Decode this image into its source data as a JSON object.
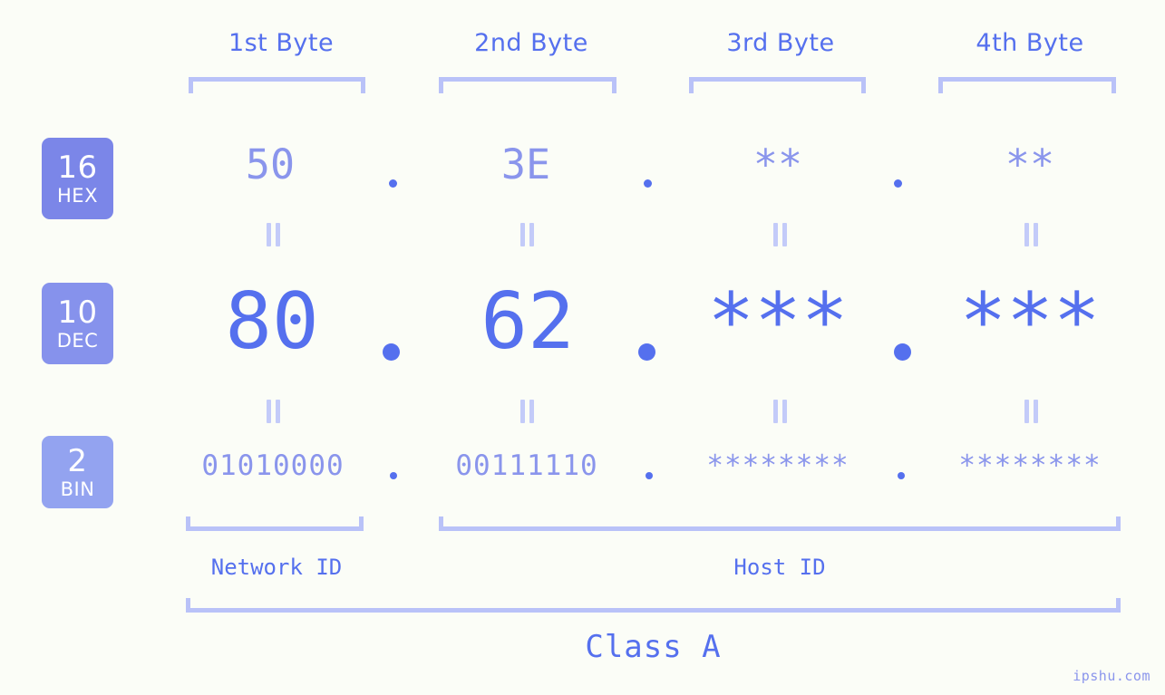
{
  "watermark": "ipshu.com",
  "byte_headers": [
    {
      "label": "1st Byte"
    },
    {
      "label": "2nd Byte"
    },
    {
      "label": "3rd Byte"
    },
    {
      "label": "4th Byte"
    }
  ],
  "radix_badges": [
    {
      "number": "16",
      "label": "HEX",
      "color": "#7b86e8"
    },
    {
      "number": "10",
      "label": "DEC",
      "color": "#8692ec"
    },
    {
      "number": "2",
      "label": "BIN",
      "color": "#93a3f0"
    }
  ],
  "rows": {
    "hex": {
      "radix": "16",
      "name": "HEX",
      "values": [
        "50",
        "3E",
        "**",
        "**"
      ],
      "separator": "."
    },
    "dec": {
      "radix": "10",
      "name": "DEC",
      "values": [
        "80",
        "62",
        "***",
        "***"
      ],
      "separator": "."
    },
    "bin": {
      "radix": "2",
      "name": "BIN",
      "values": [
        "01010000",
        "00111110",
        "********",
        "********"
      ],
      "separator": "."
    }
  },
  "equality_symbol": "=",
  "spans": {
    "network_id": "Network ID",
    "host_id": "Host ID",
    "class": "Class A"
  },
  "colors": {
    "background": "#fbfdf7",
    "accent_deep": "#5570ee",
    "accent_mid": "#7b86e8",
    "accent_light": "#9aa6f2",
    "accent_pale": "#b9c2f8"
  }
}
